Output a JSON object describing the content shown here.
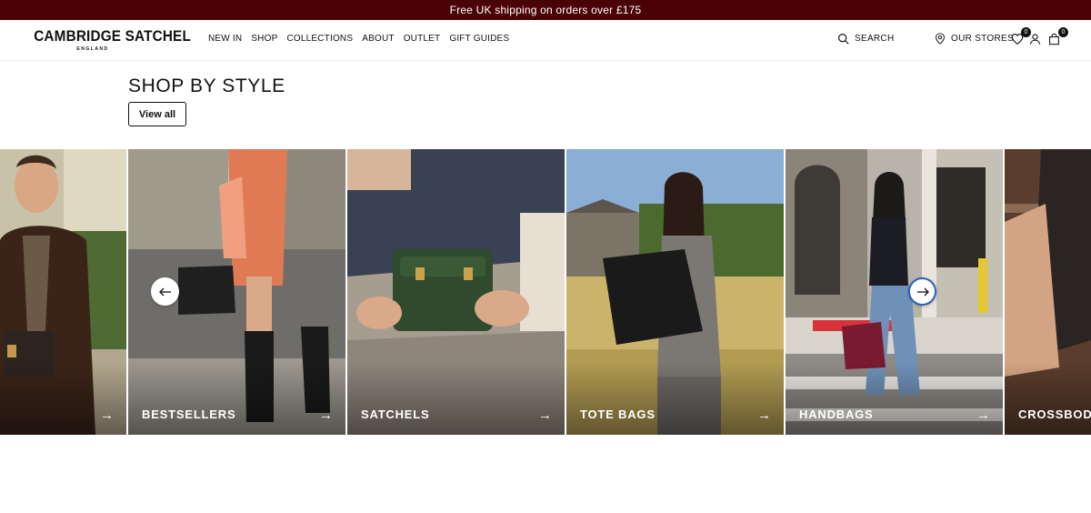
{
  "promo": {
    "text": "Free UK shipping on orders over £175"
  },
  "header": {
    "logo_main": "CAMBRIDGE SATCHEL",
    "logo_sub": "ENGLAND",
    "nav": [
      "NEW IN",
      "SHOP",
      "COLLECTIONS",
      "ABOUT",
      "OUTLET",
      "GIFT GUIDES"
    ],
    "search_label": "SEARCH",
    "stores_label": "OUR STORES",
    "wishlist_count": "0",
    "bag_count": "0",
    "icons": [
      "search-icon",
      "location-pin-icon",
      "heart-icon",
      "user-icon",
      "bag-icon"
    ]
  },
  "section": {
    "title": "SHOP BY STYLE",
    "view_all": "View all"
  },
  "carousel": {
    "cards": [
      {
        "label": ""
      },
      {
        "label": "BESTSELLERS"
      },
      {
        "label": "SATCHELS"
      },
      {
        "label": "TOTE BAGS"
      },
      {
        "label": "HANDBAGS"
      },
      {
        "label": "CROSSBODY"
      }
    ],
    "arrow_glyph": "→",
    "prev_icon": "arrow-left-icon",
    "next_icon": "arrow-right-icon"
  },
  "colors": {
    "promo_bg": "#4a0206",
    "text": "#111111",
    "focus_ring": "#2a62b8"
  }
}
